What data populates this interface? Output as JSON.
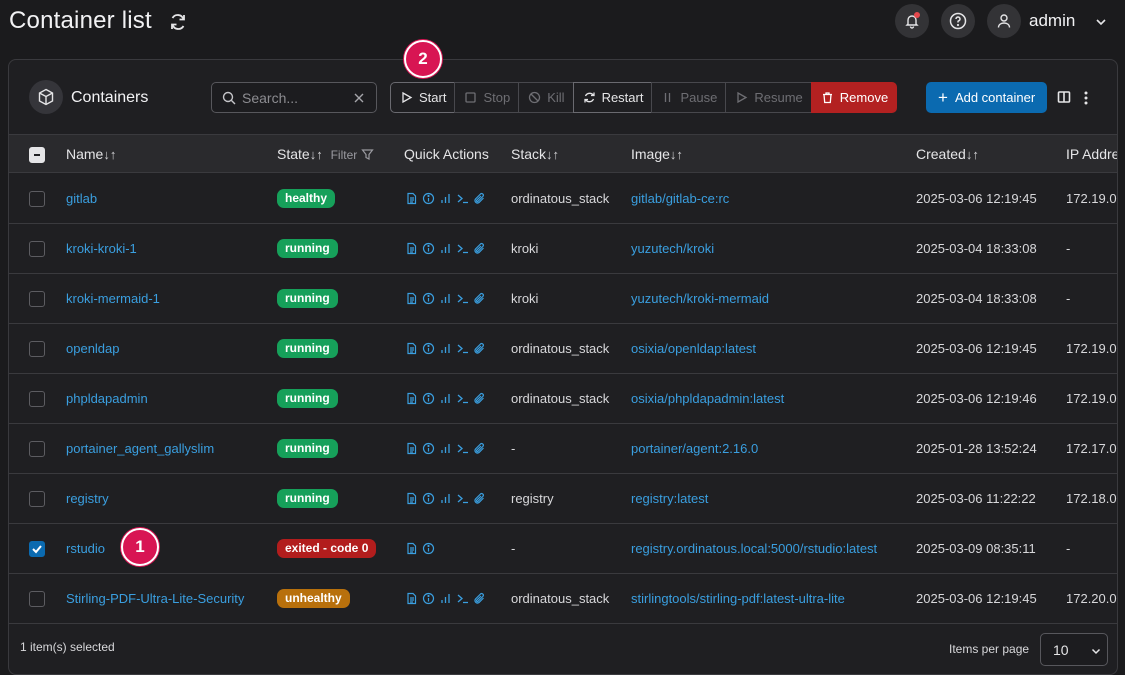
{
  "header": {
    "title": "Container list",
    "username": "admin"
  },
  "panel": {
    "title": "Containers",
    "search_placeholder": "Search...",
    "actions": [
      {
        "label": "Start",
        "enabled": true
      },
      {
        "label": "Stop",
        "enabled": false
      },
      {
        "label": "Kill",
        "enabled": false
      },
      {
        "label": "Restart",
        "enabled": true
      },
      {
        "label": "Pause",
        "enabled": false
      },
      {
        "label": "Resume",
        "enabled": false
      },
      {
        "label": "Remove",
        "enabled": true
      }
    ],
    "add_button": "Add container"
  },
  "table": {
    "columns": {
      "name": "Name",
      "state": "State",
      "filter": "Filter",
      "quick_actions": "Quick Actions",
      "stack": "Stack",
      "image": "Image",
      "created": "Created",
      "ip": "IP Addre"
    },
    "sort_glyph": "↓↑",
    "rows": [
      {
        "name": "gitlab",
        "state": "healthy",
        "quick": 5,
        "stack": "ordinatous_stack",
        "image": "gitlab/gitlab-ce:rc",
        "created": "2025-03-06 12:19:45",
        "ip": "172.19.0.",
        "selected": false
      },
      {
        "name": "kroki-kroki-1",
        "state": "running",
        "quick": 5,
        "stack": "kroki",
        "image": "yuzutech/kroki",
        "created": "2025-03-04 18:33:08",
        "ip": "-",
        "selected": false
      },
      {
        "name": "kroki-mermaid-1",
        "state": "running",
        "quick": 5,
        "stack": "kroki",
        "image": "yuzutech/kroki-mermaid",
        "created": "2025-03-04 18:33:08",
        "ip": "-",
        "selected": false
      },
      {
        "name": "openldap",
        "state": "running",
        "quick": 5,
        "stack": "ordinatous_stack",
        "image": "osixia/openldap:latest",
        "created": "2025-03-06 12:19:45",
        "ip": "172.19.0.",
        "selected": false
      },
      {
        "name": "phpldapadmin",
        "state": "running",
        "quick": 5,
        "stack": "ordinatous_stack",
        "image": "osixia/phpldapadmin:latest",
        "created": "2025-03-06 12:19:46",
        "ip": "172.19.0.",
        "selected": false
      },
      {
        "name": "portainer_agent_gallyslim",
        "state": "running",
        "quick": 5,
        "stack": "-",
        "image": "portainer/agent:2.16.0",
        "created": "2025-01-28 13:52:24",
        "ip": "172.17.0.",
        "selected": false
      },
      {
        "name": "registry",
        "state": "running",
        "quick": 5,
        "stack": "registry",
        "image": "registry:latest",
        "created": "2025-03-06 11:22:22",
        "ip": "172.18.0.",
        "selected": false
      },
      {
        "name": "rstudio",
        "state": "exited - code 0",
        "quick": 2,
        "stack": "-",
        "image": "registry.ordinatous.local:5000/rstudio:latest",
        "created": "2025-03-09 08:35:11",
        "ip": "-",
        "selected": true
      },
      {
        "name": "Stirling-PDF-Ultra-Lite-Security",
        "state": "unhealthy",
        "quick": 5,
        "stack": "ordinatous_stack",
        "image": "stirlingtools/stirling-pdf:latest-ultra-lite",
        "created": "2025-03-06 12:19:45",
        "ip": "172.20.0.",
        "selected": false
      }
    ]
  },
  "footer": {
    "selected_text": "1 item(s) selected",
    "items_per_page_label": "Items per page",
    "items_per_page": "10"
  },
  "markers": [
    {
      "label": "1"
    },
    {
      "label": "2"
    }
  ],
  "colors": {
    "healthy": "#16a05a",
    "running": "#16a05a",
    "exited": "#b21d1d",
    "unhealthy": "#b8700c",
    "accent": "#0b6ab0",
    "link": "#3a9fe0",
    "marker": "#d81553"
  }
}
